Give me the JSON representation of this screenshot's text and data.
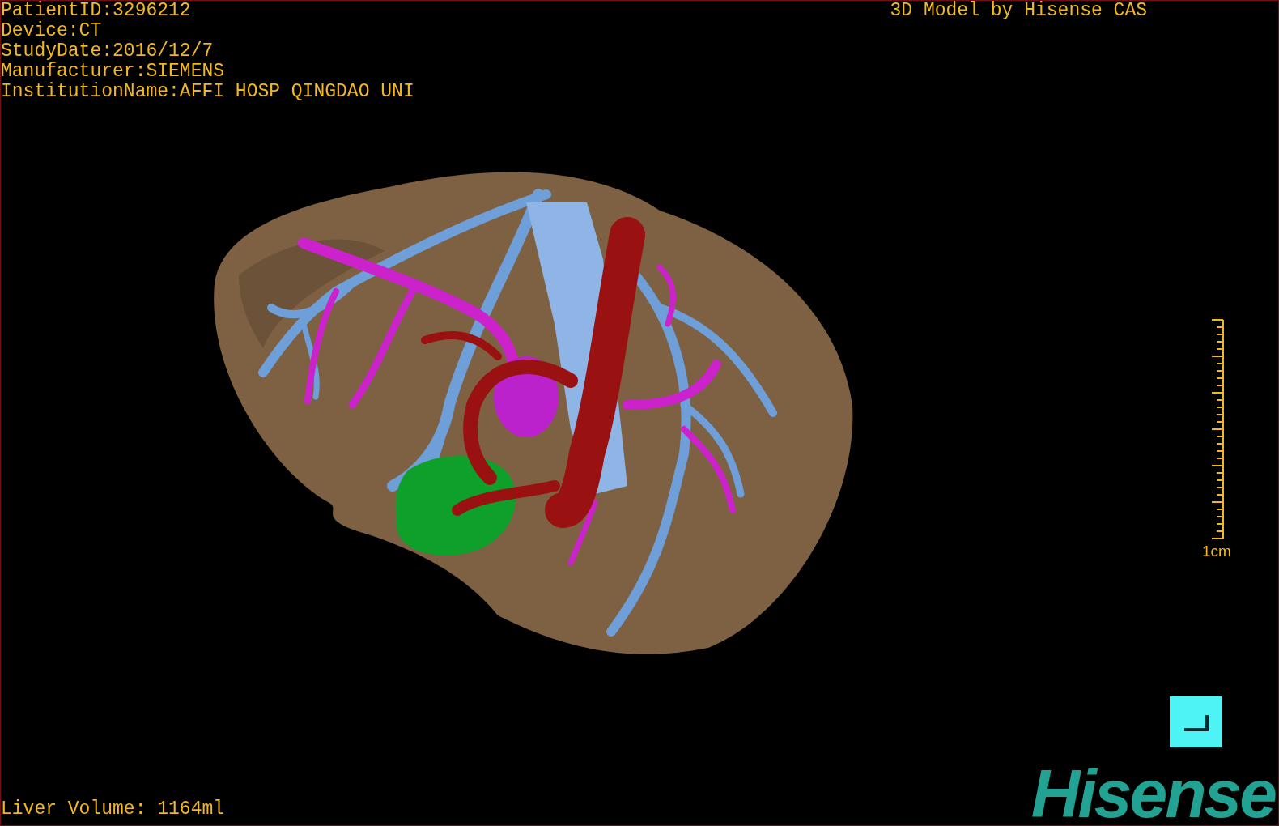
{
  "patient_info": [
    "PatientID:3296212",
    "Device:CT",
    "StudyDate:2016/12/7",
    "Manufacturer:SIEMENS",
    "InstitutionName:AFFI HOSP QINGDAO UNI"
  ],
  "title": "3D Model by Hisense CAS",
  "scale_bar": {
    "label": "1cm"
  },
  "liver_volume": "Liver Volume: 1164ml",
  "logo": "Hisense"
}
